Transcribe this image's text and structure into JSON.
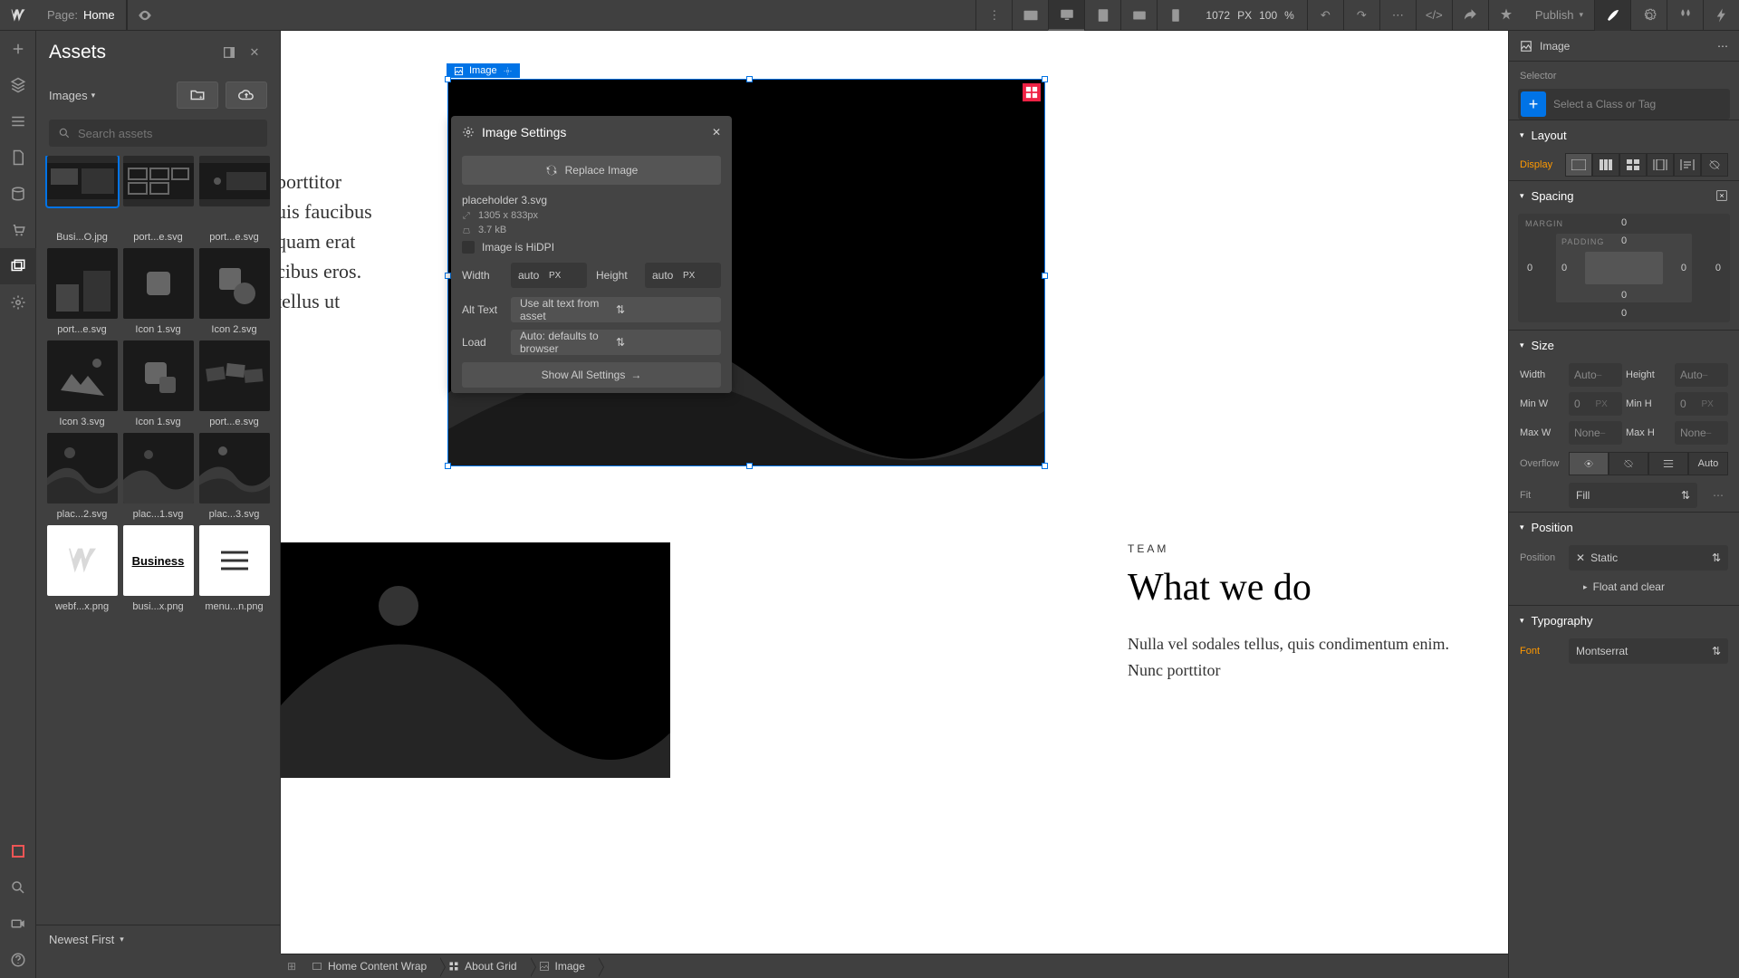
{
  "topbar": {
    "page_label": "Page:",
    "page_name": "Home",
    "canvas_width": "1072",
    "canvas_width_unit": "PX",
    "zoom": "100",
    "zoom_unit": "%",
    "publish_label": "Publish"
  },
  "assets": {
    "title": "Assets",
    "filter_label": "Images",
    "search_placeholder": "Search assets",
    "sort_label": "Newest First",
    "items": [
      {
        "name": "Busi...O.jpg"
      },
      {
        "name": "port...e.svg"
      },
      {
        "name": "port...e.svg"
      },
      {
        "name": "port...e.svg"
      },
      {
        "name": "Icon 1.svg"
      },
      {
        "name": "Icon 2.svg"
      },
      {
        "name": "Icon 3.svg"
      },
      {
        "name": "Icon 1.svg"
      },
      {
        "name": "port...e.svg"
      },
      {
        "name": "plac...2.svg"
      },
      {
        "name": "plac...1.svg"
      },
      {
        "name": "plac...3.svg"
      },
      {
        "name": "webf...x.png"
      },
      {
        "name": "busi...x.png"
      },
      {
        "name": "menu...n.png"
      }
    ]
  },
  "canvas": {
    "element_badge": "Image",
    "text_block": "porttitor\nuis faucibus\nquam erat\ncibus eros.\ntellus ut",
    "eyebrow": "TEAM",
    "heading": "What we do",
    "paragraph": "Nulla vel sodales tellus, quis condimentum enim. Nunc porttitor"
  },
  "modal": {
    "title": "Image Settings",
    "replace_label": "Replace Image",
    "filename": "placeholder 3.svg",
    "dimensions": "1305 x 833px",
    "filesize": "3.7 kB",
    "hidpi_label": "Image is HiDPI",
    "width_label": "Width",
    "width_value": "auto",
    "height_label": "Height",
    "height_value": "auto",
    "px_unit": "PX",
    "alt_label": "Alt Text",
    "alt_value": "Use alt text from asset",
    "load_label": "Load",
    "load_value": "Auto: defaults to browser",
    "show_all": "Show All Settings"
  },
  "breadcrumb": {
    "items": [
      "Home Content Wrap",
      "About Grid",
      "Image"
    ]
  },
  "right": {
    "element_label": "Image",
    "selector_section": "Selector",
    "selector_placeholder": "Select a Class or Tag",
    "layout_title": "Layout",
    "display_label": "Display",
    "spacing_title": "Spacing",
    "margin_label": "MARGIN",
    "padding_label": "PADDING",
    "zero": "0",
    "size_title": "Size",
    "width_l": "Width",
    "height_l": "Height",
    "minw_l": "Min W",
    "minh_l": "Min H",
    "maxw_l": "Max W",
    "maxh_l": "Max H",
    "auto_ph": "Auto",
    "zero_ph": "0",
    "none_ph": "None",
    "px_unit": "PX",
    "dash_unit": "–",
    "overflow_l": "Overflow",
    "overflow_auto": "Auto",
    "fit_l": "Fit",
    "fit_value": "Fill",
    "position_title": "Position",
    "position_l": "Position",
    "position_value": "Static",
    "float_clear": "Float and clear",
    "typo_title": "Typography",
    "font_l": "Font",
    "font_value": "Montserrat"
  }
}
